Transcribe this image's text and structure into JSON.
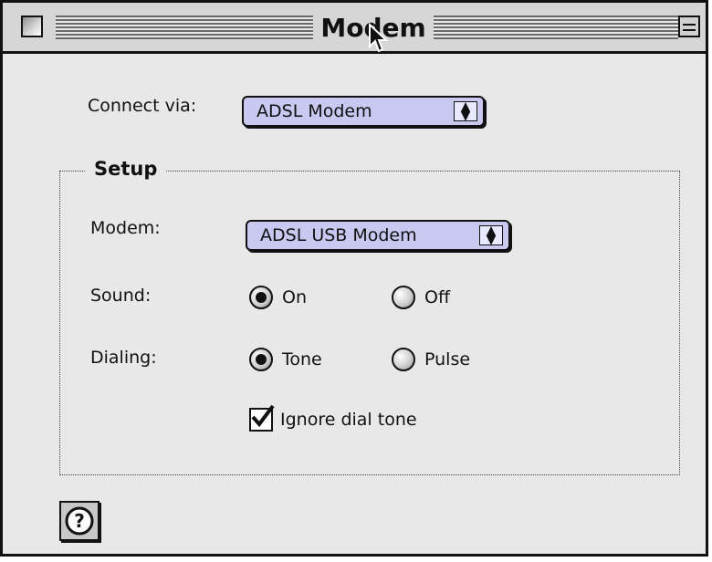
{
  "window": {
    "title": "Modem"
  },
  "connect": {
    "label": "Connect via:",
    "value": "ADSL Modem"
  },
  "setup": {
    "title": "Setup",
    "modem": {
      "label": "Modem:",
      "value": "ADSL USB Modem"
    },
    "sound": {
      "label": "Sound:",
      "options": [
        "On",
        "Off"
      ],
      "selected": "On"
    },
    "dialing": {
      "label": "Dialing:",
      "options": [
        "Tone",
        "Pulse"
      ],
      "selected": "Tone"
    },
    "ignore_dial_tone": {
      "label": "Ignore dial tone",
      "checked": true
    }
  },
  "icons": {
    "close": "close-box",
    "zoom": "zoom-box",
    "popup": "up-down-arrows-icon",
    "help": "help-question-icon",
    "cursor": "mouse-pointer-icon"
  },
  "colors": {
    "popup_fill": "#c8c8f0",
    "window_bg": "#e8e8e8"
  }
}
